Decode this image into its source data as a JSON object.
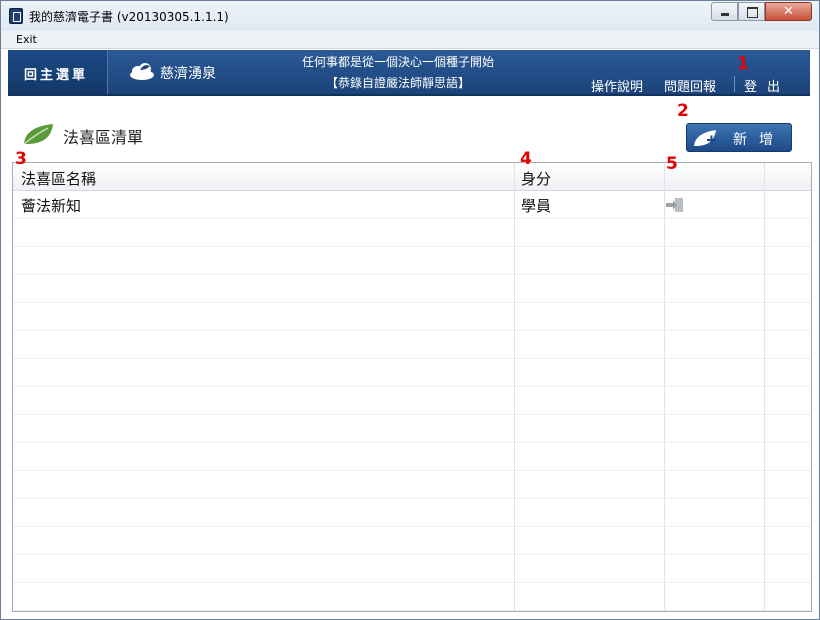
{
  "window": {
    "title": "我的慈濟電子書 (v20130305.1.1.1)"
  },
  "menu": {
    "exit_label": "Exit"
  },
  "nav": {
    "home_label": "回主選單",
    "source_label": "慈濟湧泉",
    "quote_line1": "任何事都是從一個決心一個種子開始",
    "quote_line2": "【恭錄自證嚴法師靜思語】",
    "help_label": "操作說明",
    "feedback_label": "問題回報",
    "logout_label": "登出"
  },
  "section": {
    "title": "法喜區清單",
    "add_label": "新增"
  },
  "table": {
    "columns": [
      "法喜區名稱",
      "身分"
    ],
    "rows": [
      {
        "name": "薈法新知",
        "role": "學員",
        "action_icon": "exit-door-icon"
      }
    ],
    "empty_rows": 14
  },
  "markers": [
    "1",
    "2",
    "3",
    "4",
    "5"
  ],
  "colors": {
    "nav_blue": "#2a5a98",
    "nav_dark": "#1c4379",
    "marker_red": "#e60000",
    "leaf_green": "#5a9a3a"
  }
}
